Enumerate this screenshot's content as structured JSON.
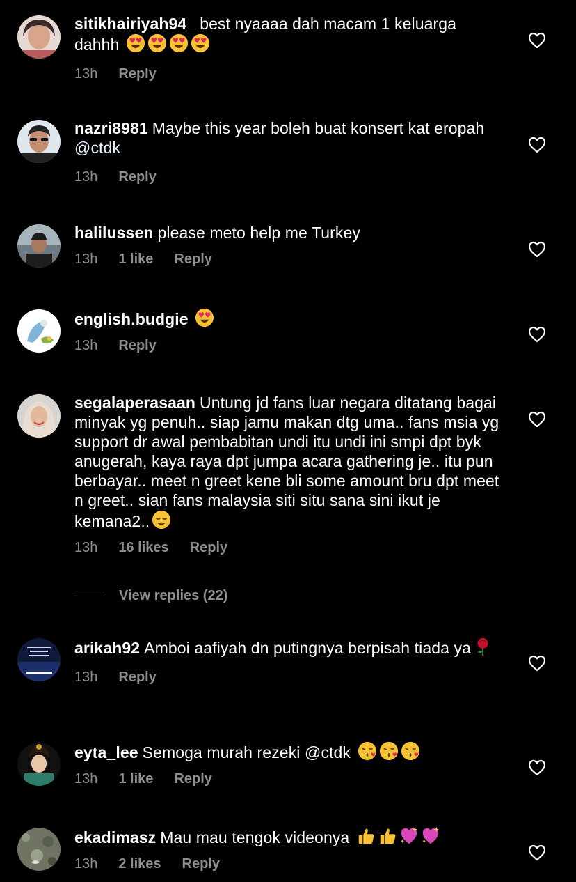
{
  "comments": [
    {
      "username": "sitikhairiyah94_",
      "text": "best nyaaaa dah macam 1 keluarga dahhh",
      "emojis": [
        "heart-eyes",
        "heart-eyes",
        "heart-eyes",
        "heart-eyes"
      ],
      "time": "13h",
      "likes": "",
      "reply": "Reply"
    },
    {
      "username": "nazri8981",
      "text": "Maybe this year boleh buat konsert kat eropah",
      "mention": "@ctdk",
      "time": "13h",
      "likes": "",
      "reply": "Reply"
    },
    {
      "username": "halilussen",
      "text": "please meto help me Turkey",
      "time": "13h",
      "likes": "1 like",
      "reply": "Reply"
    },
    {
      "username": "english.budgie",
      "text": "",
      "emojis": [
        "heart-eyes"
      ],
      "time": "13h",
      "likes": "",
      "reply": "Reply"
    },
    {
      "username": "segalaperasaan",
      "text": "Untung jd fans luar negara ditatang bagai minyak yg penuh.. siap jamu makan dtg uma.. fans msia yg support dr awal pembabitan undi itu undi ini smpi dpt byk anugerah, kaya raya dpt jumpa acara gathering je.. itu pun berbayar.. meet n greet kene bli some amount bru dpt meet n greet.. sian fans malaysia siti situ sana sini ikut je kemana2..",
      "emojis": [
        "relieved"
      ],
      "time": "13h",
      "likes": "16 likes",
      "reply": "Reply"
    },
    {
      "username": "arikah92",
      "text": "Amboi aafiyah dn putingnya berpisah tiada ya",
      "emojis": [
        "rose"
      ],
      "time": "13h",
      "likes": "",
      "reply": "Reply"
    },
    {
      "username": "eyta_lee",
      "text": "Semoga murah rezeki @ctdk",
      "emojis": [
        "kiss",
        "kiss",
        "kiss"
      ],
      "time": "13h",
      "likes": "1 like",
      "reply": "Reply"
    },
    {
      "username": "ekadimasz",
      "text": "Mau mau tengok videonya",
      "emojis": [
        "thumbs-up",
        "thumbs-up",
        "sparkling-heart",
        "sparkling-heart"
      ],
      "time": "13h",
      "likes": "2 likes",
      "reply": "Reply"
    }
  ],
  "view_replies": "View replies (22)",
  "colors": {
    "background": "#000000",
    "text": "#ffffff",
    "meta": "#8e8e8e",
    "mention": "#e0f1ff"
  }
}
